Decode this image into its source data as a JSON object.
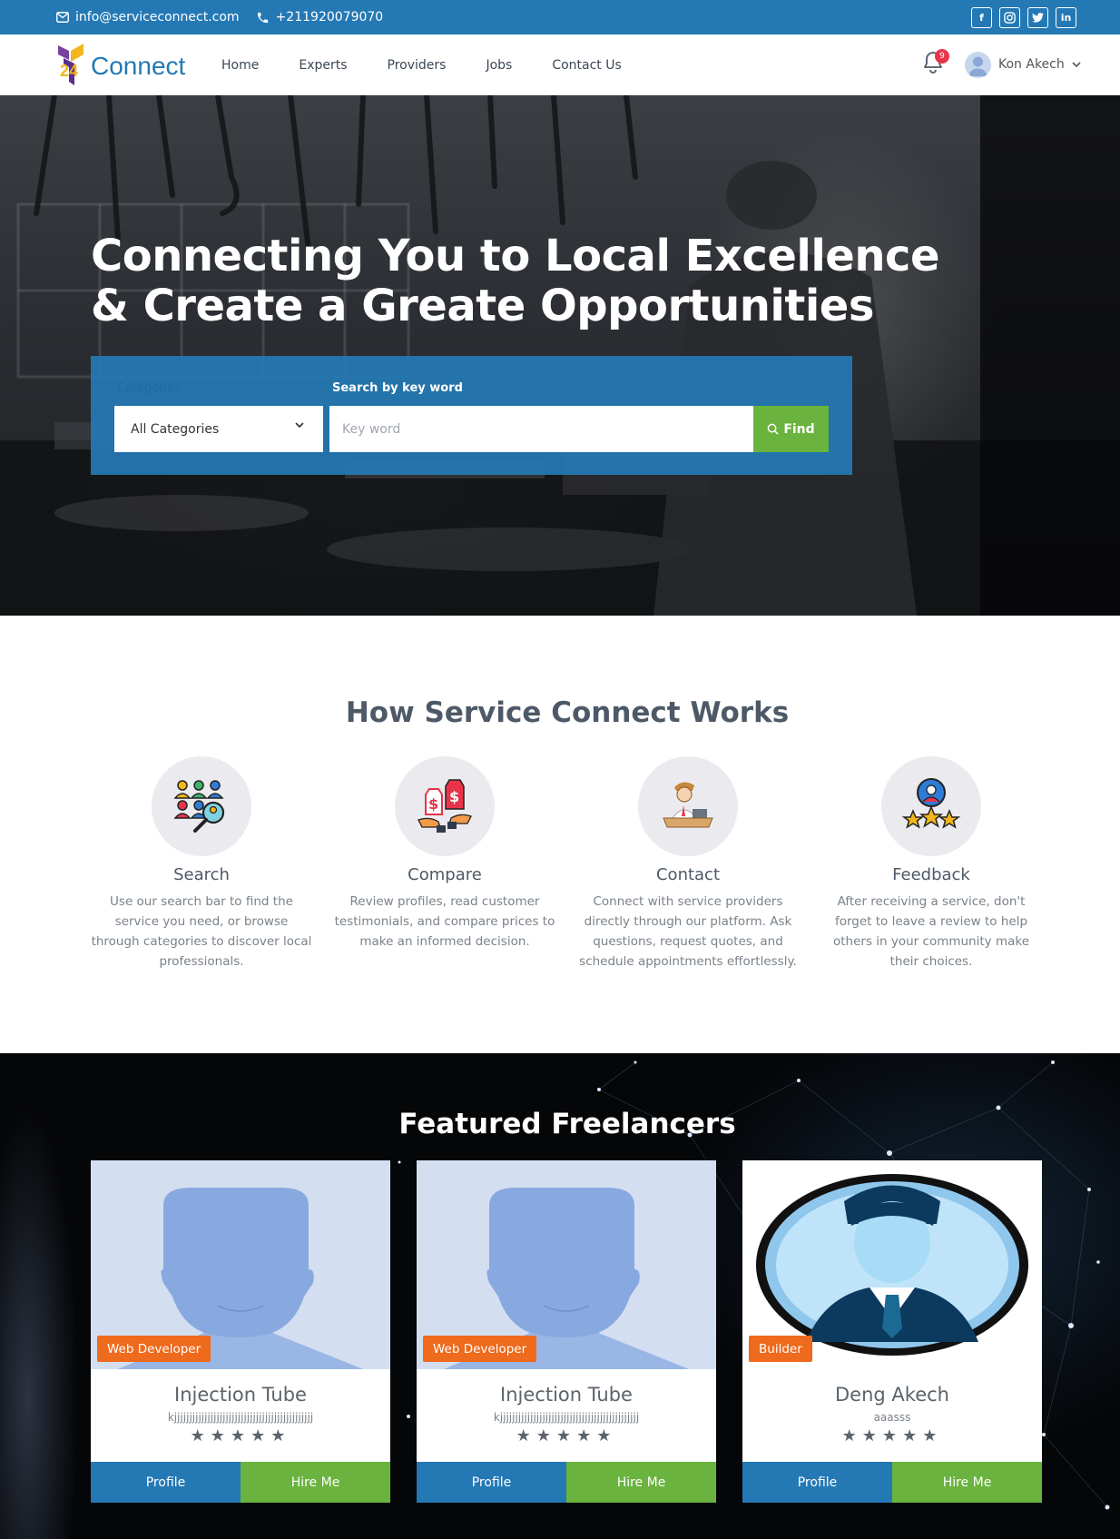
{
  "topbar": {
    "email": "info@serviceconnect.com",
    "phone": "+211920079070",
    "socials": [
      "facebook-icon",
      "instagram-icon",
      "twitter-icon",
      "linkedin-icon"
    ]
  },
  "nav": {
    "logo_text": "Connect",
    "links": [
      "Home",
      "Experts",
      "Providers",
      "Jobs",
      "Contact Us"
    ],
    "notification_count": "9",
    "user_name": "Kon Akech"
  },
  "hero": {
    "headline_line1": "Connecting You to Local Excellence",
    "headline_line2": "& Create a Greate Opportunities",
    "categories_label": "Categories",
    "category_selected": "All Categories",
    "keyword_label": "Search by key word",
    "keyword_placeholder": "Key word",
    "find_label": "Find"
  },
  "how": {
    "title": "How Service Connect Works",
    "steps": [
      {
        "name": "Search",
        "desc": "Use our search bar to find the service you need, or browse through categories to discover local professionals."
      },
      {
        "name": "Compare",
        "desc": "Review profiles, read customer testimonials, and compare prices to make an informed decision."
      },
      {
        "name": "Contact",
        "desc": "Connect with service providers directly through our platform. Ask questions, request quotes, and schedule appointments effortlessly."
      },
      {
        "name": "Feedback",
        "desc": "After receiving a service, don't forget to leave a review to help others in your community make their choices."
      }
    ]
  },
  "featured": {
    "title": "Featured Freelancers",
    "profile_label": "Profile",
    "hire_label": "Hire Me",
    "stars": "★★★★★",
    "cards": [
      {
        "tag": "Web Developer",
        "name": "Injection Tube",
        "subtitle": "kjjjjjjjjjjjjjjjjjjjjjjjjjjjjjjjjjjjjjjjjjjjjjj"
      },
      {
        "tag": "Web Developer",
        "name": "Injection Tube",
        "subtitle": "kjjjjjjjjjjjjjjjjjjjjjjjjjjjjjjjjjjjjjjjjjjjjjj"
      },
      {
        "tag": "Builder",
        "name": "Deng Akech",
        "subtitle": "aaasss"
      }
    ]
  },
  "colors": {
    "brand_blue": "#2479b5",
    "accent_green": "#6ab33e",
    "tag_orange": "#ee6a1c"
  }
}
